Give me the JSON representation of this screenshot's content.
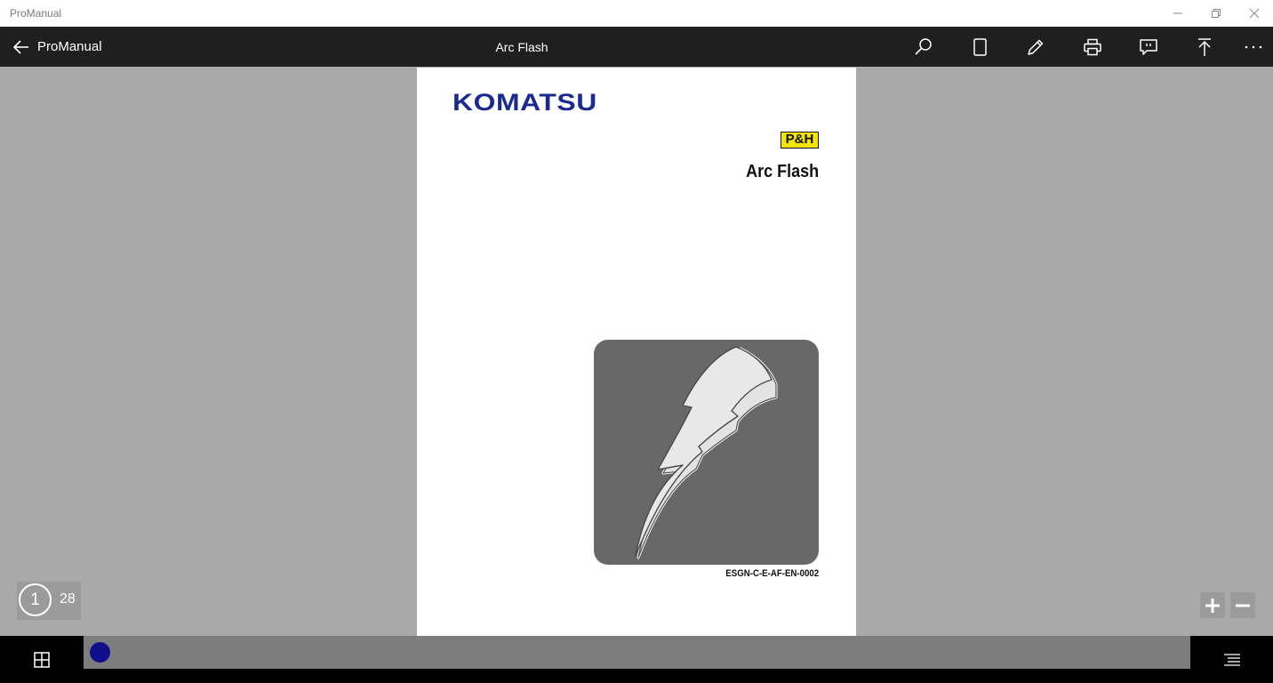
{
  "window": {
    "title": "ProManual"
  },
  "appbar": {
    "back_label": "ProManual",
    "doc_title": "Arc Flash",
    "tools": [
      "search-icon",
      "page-view-icon",
      "pen-icon",
      "print-icon",
      "comment-icon",
      "go-to-top-icon",
      "more-icon"
    ]
  },
  "document": {
    "brand": "KOMATSU",
    "sub_brand": "P&H",
    "heading": "Arc Flash",
    "code": "ESGN-C-E-AF-EN-0002",
    "brand_color": "#1b2a8f",
    "sub_brand_color": "#f4e400"
  },
  "page_counter": {
    "current": "1",
    "total": "28"
  },
  "colors": {
    "toolbar": "#1f1f1f",
    "viewer_bg": "#a9a9a9",
    "thumb_dot": "#0f0f8c"
  }
}
